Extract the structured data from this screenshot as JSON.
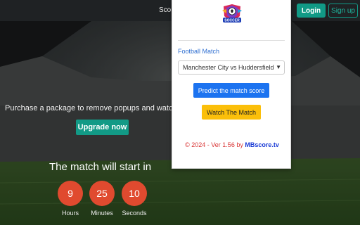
{
  "header": {
    "nav_text": "Sco",
    "login_label": "Login",
    "signup_label": "Sign up"
  },
  "promo": {
    "text": "Purchase a package to remove popups and watch fu",
    "upgrade_label": "Upgrade now"
  },
  "countdown": {
    "title": "The match will start in",
    "hours": "9",
    "minutes": "25",
    "seconds": "10",
    "hours_label": "Hours",
    "minutes_label": "Minutes",
    "seconds_label": "Seconds"
  },
  "popup": {
    "logo_text": "SOCCER",
    "field_label": "Football Match",
    "selected_match": "Manchester City vs Huddersfield",
    "predict_label": "Predict the match score",
    "watch_label": "Watch The Match",
    "footer_prefix": "© 2024 - Ver 1.56 by",
    "footer_brand": "MBscore.tv"
  },
  "colors": {
    "accent_teal": "#119a86",
    "countdown_red": "#e04a2f",
    "primary_blue": "#1c73f0",
    "warning_yellow": "#fbbf0a"
  }
}
